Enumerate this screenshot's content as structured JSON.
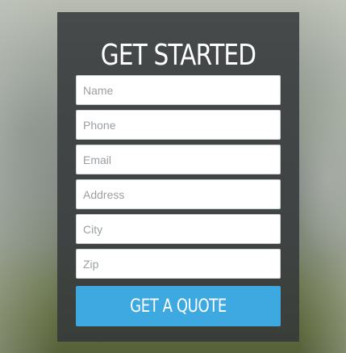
{
  "form": {
    "title": "GET STARTED",
    "fields": [
      {
        "placeholder": "Name",
        "value": ""
      },
      {
        "placeholder": "Phone",
        "value": ""
      },
      {
        "placeholder": "Email",
        "value": ""
      },
      {
        "placeholder": "Address",
        "value": ""
      },
      {
        "placeholder": "City",
        "value": ""
      },
      {
        "placeholder": "Zip",
        "value": ""
      }
    ],
    "submit_label": "GET A QUOTE"
  },
  "colors": {
    "panel_background": "#34383a",
    "button_background": "#3ea9e0",
    "title_text": "#ffffff"
  }
}
